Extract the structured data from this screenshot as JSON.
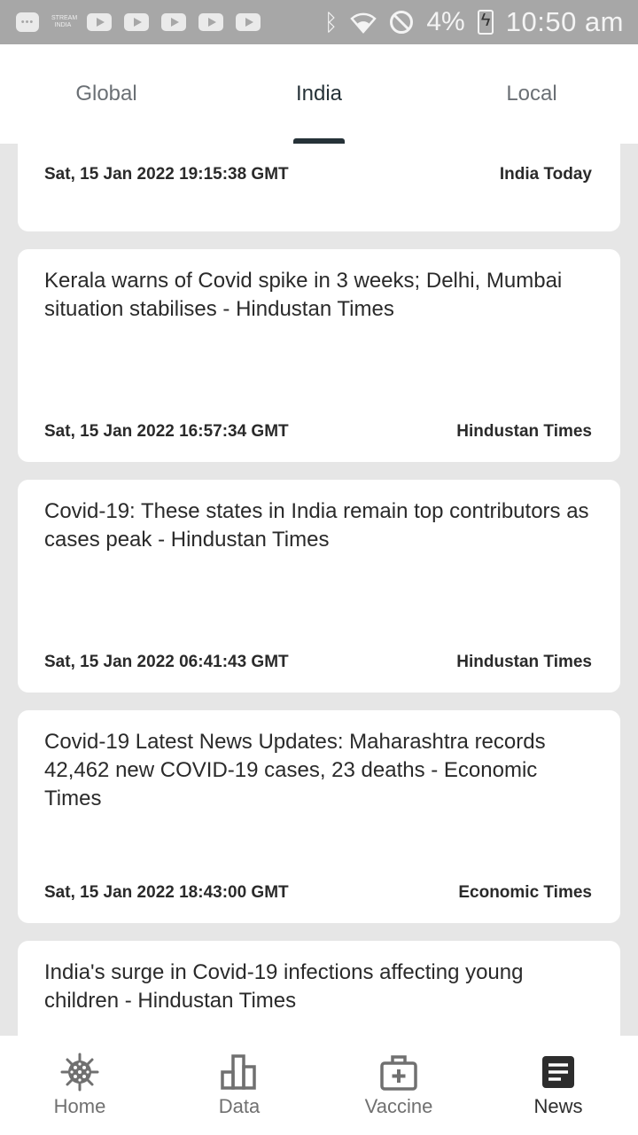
{
  "status_bar": {
    "stream_label": "STREAM INDIA",
    "battery": "4%",
    "time": "10:50 am"
  },
  "tabs": [
    {
      "label": "Global",
      "active": false
    },
    {
      "label": "India",
      "active": true
    },
    {
      "label": "Local",
      "active": false
    }
  ],
  "news": [
    {
      "title": "",
      "date": "Sat, 15 Jan 2022 19:15:38 GMT",
      "source": "India Today"
    },
    {
      "title": "Kerala warns of Covid spike in 3 weeks; Delhi, Mumbai situation stabilises - Hindustan Times",
      "date": "Sat, 15 Jan 2022 16:57:34 GMT",
      "source": "Hindustan Times"
    },
    {
      "title": "Covid-19: These states in India remain top contributors as cases peak - Hindustan Times",
      "date": "Sat, 15 Jan 2022 06:41:43 GMT",
      "source": "Hindustan Times"
    },
    {
      "title": "Covid-19 Latest News Updates: Maharashtra records 42,462 new COVID-19 cases, 23 deaths - Economic Times",
      "date": "Sat, 15 Jan 2022 18:43:00 GMT",
      "source": "Economic Times"
    },
    {
      "title": "India's surge in Covid-19 infections affecting young children - Hindustan Times",
      "date": "",
      "source": ""
    }
  ],
  "bottom_nav": [
    {
      "label": "Home",
      "icon": "virus-icon",
      "active": false
    },
    {
      "label": "Data",
      "icon": "bar-chart-icon",
      "active": false
    },
    {
      "label": "Vaccine",
      "icon": "medical-kit-icon",
      "active": false
    },
    {
      "label": "News",
      "icon": "news-icon",
      "active": true
    }
  ],
  "colors": {
    "status_bar": "#a7a7a7",
    "background": "#e6e6e6",
    "active_text": "#263238",
    "inactive_text": "#6b7075"
  }
}
